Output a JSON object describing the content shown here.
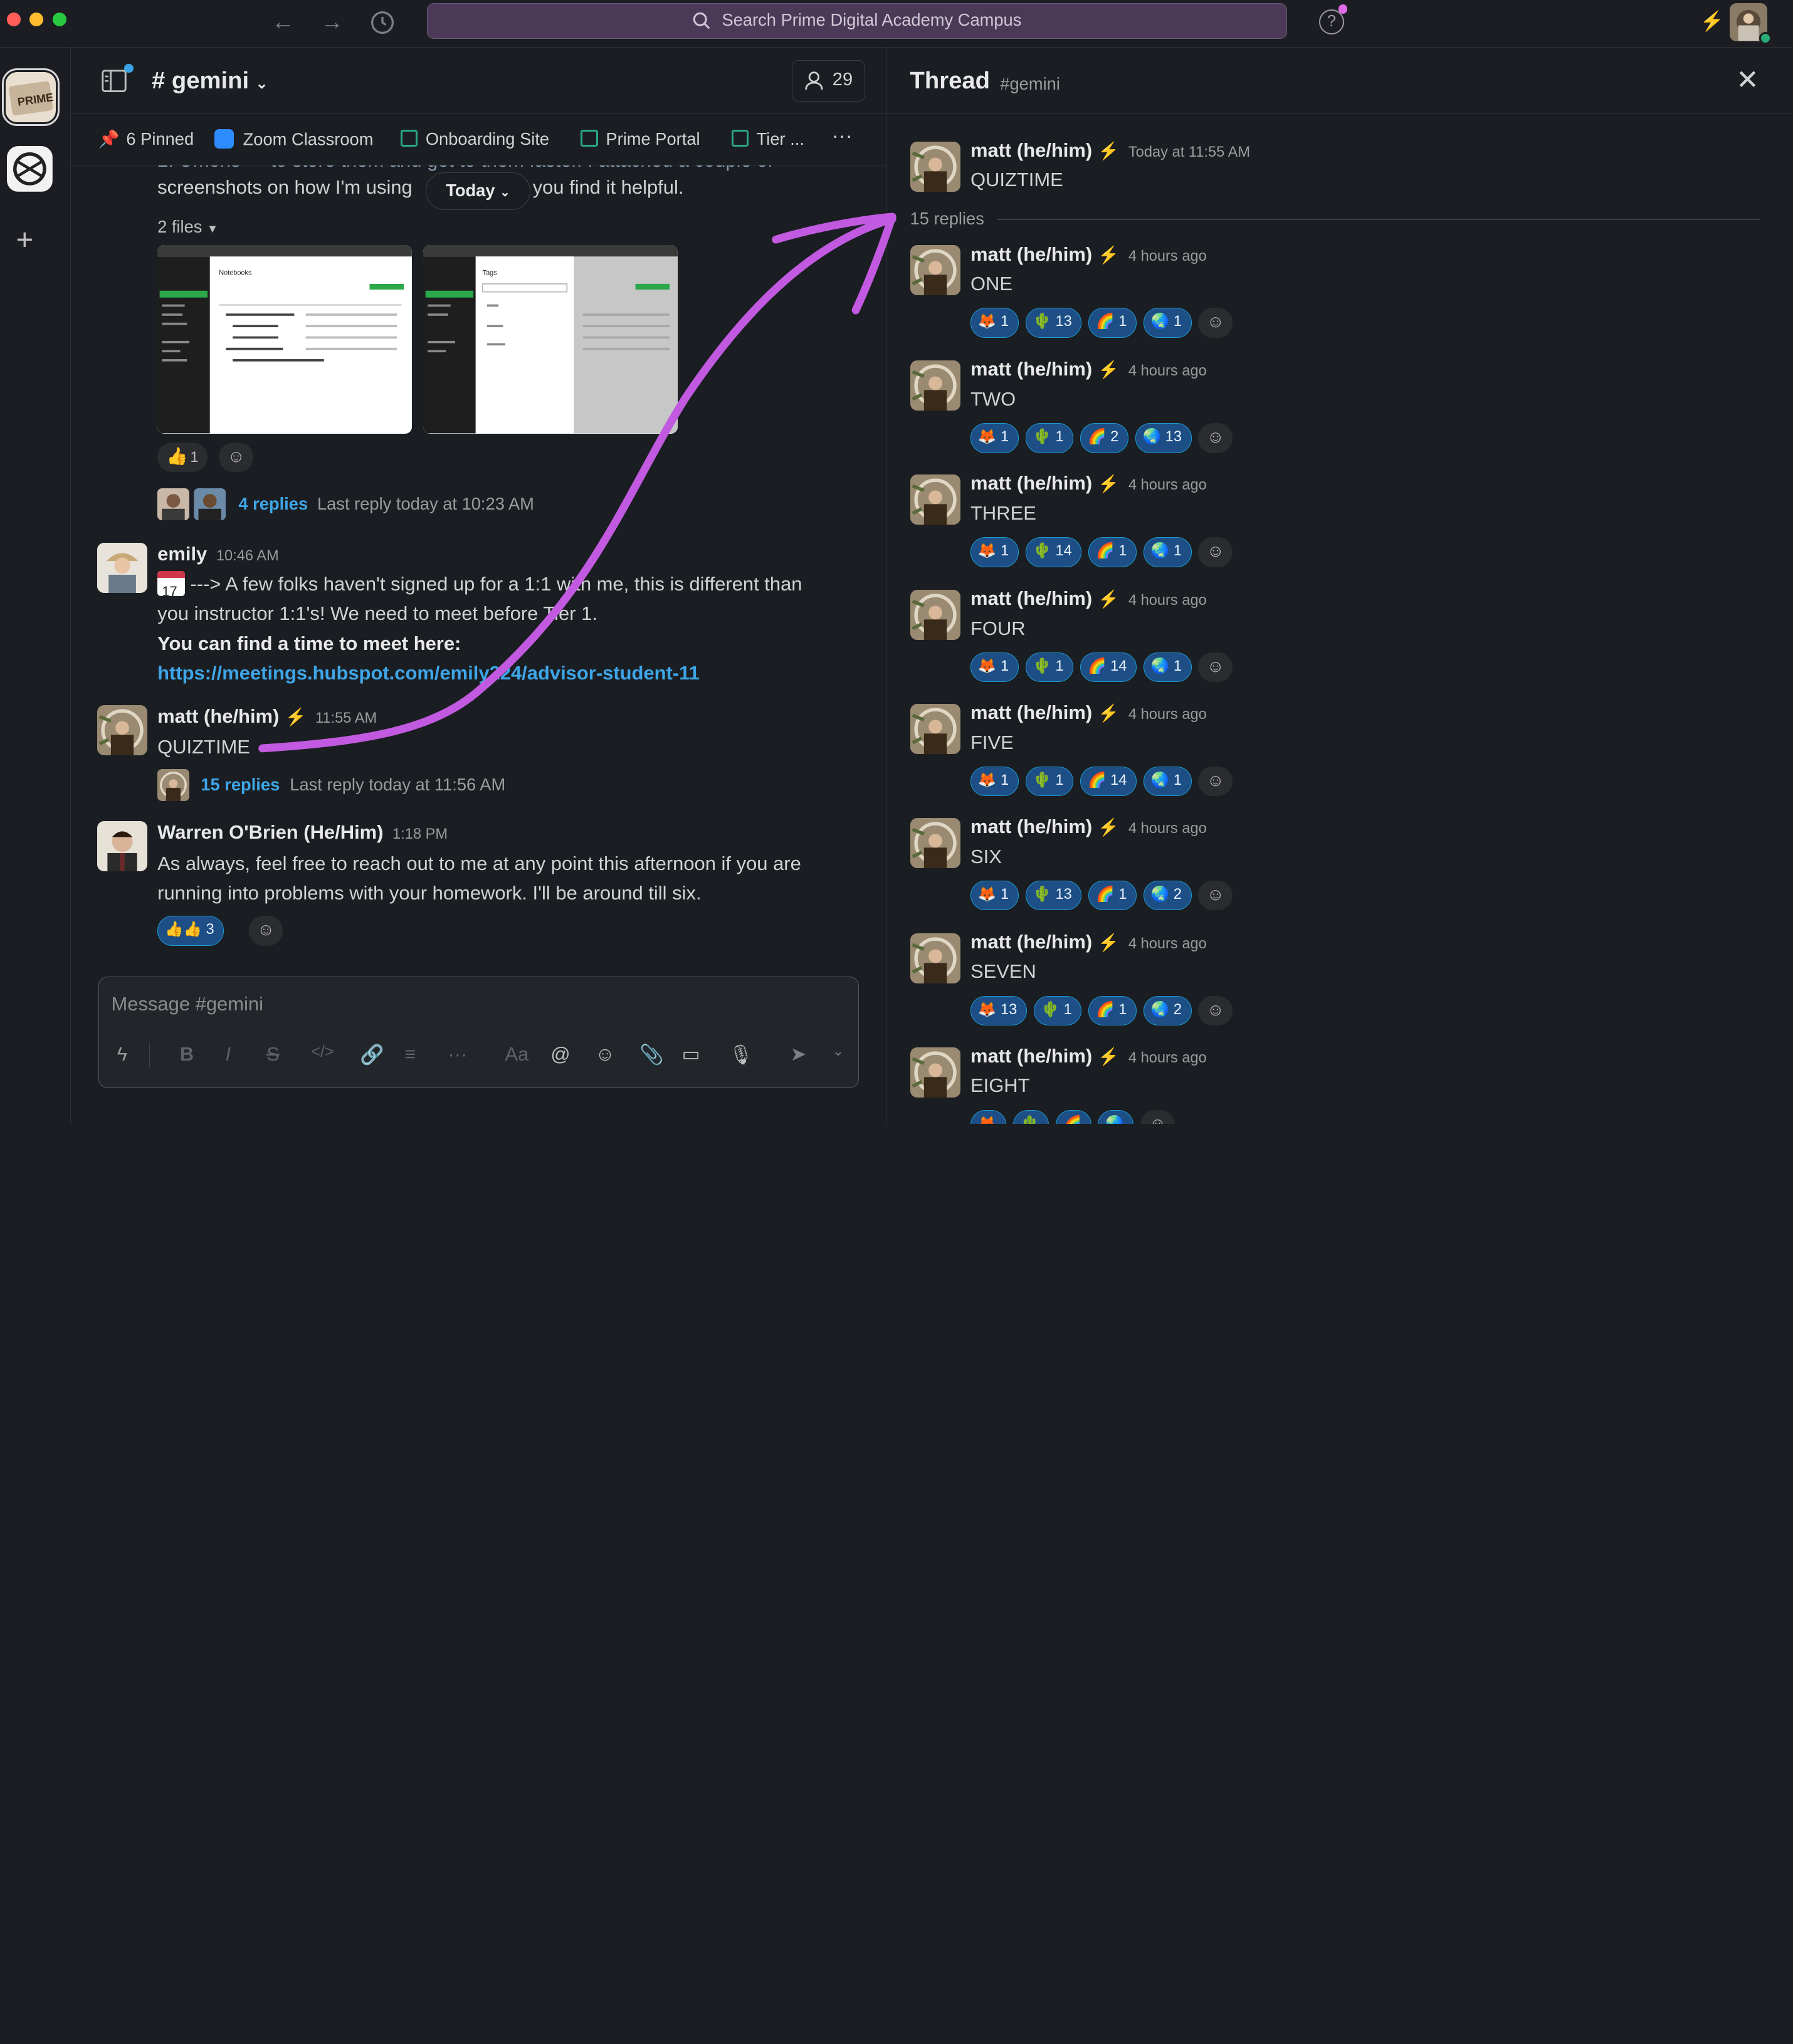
{
  "search": {
    "placeholder": "Search Prime Digital Academy Campus"
  },
  "channel": {
    "name": "# gemini",
    "members": "29"
  },
  "bookmarks": [
    "6 Pinned",
    "Zoom Classroom",
    "Onboarding Site",
    "Prime Portal",
    "Tier ..."
  ],
  "main": {
    "partial_line1": "screenshots on how I'm using",
    "partial_line1b": "f you find it helpful.",
    "date_divider": "Today",
    "files_label": "2 files",
    "thumbs_up_count": "1",
    "replies1": "4 replies",
    "last_reply1": "Last reply today at 10:23 AM",
    "emily": {
      "name": "emily",
      "time": "10:46 AM",
      "line1": "---> A few folks haven't signed up for a 1:1 with me, this is different than",
      "line2": "you instructor 1:1's! We need to meet before Tier 1.",
      "line3": "You can find a time to meet here:",
      "link": "https://meetings.hubspot.com/emily224/advisor-student-11",
      "calendar_day": "17"
    },
    "matt": {
      "name": "matt (he/him)",
      "time": "11:55 AM",
      "text": "QUIZTIME",
      "replies": "15 replies",
      "last_reply": "Last reply today at 11:56 AM"
    },
    "warren": {
      "name": "Warren O'Brien (He/Him)",
      "time": "1:18 PM",
      "line1": "As always, feel free to reach out to me at any point this afternoon if you are",
      "line2": "running into problems with your homework. I'll be around till six.",
      "reaction_count": "3"
    },
    "composer_placeholder": "Message #gemini"
  },
  "thread": {
    "title": "Thread",
    "channel": "#gemini",
    "parent": {
      "name": "matt (he/him)",
      "time": "Today at 11:55 AM",
      "text": "QUIZTIME"
    },
    "reply_count": "15 replies",
    "replies": [
      {
        "name": "matt (he/him)",
        "time": "4 hours ago",
        "text": "ONE",
        "counts": [
          "1",
          "13",
          "1",
          "1"
        ]
      },
      {
        "name": "matt (he/him)",
        "time": "4 hours ago",
        "text": "TWO",
        "counts": [
          "1",
          "1",
          "2",
          "13"
        ]
      },
      {
        "name": "matt (he/him)",
        "time": "4 hours ago",
        "text": "THREE",
        "counts": [
          "1",
          "14",
          "1",
          "1"
        ]
      },
      {
        "name": "matt (he/him)",
        "time": "4 hours ago",
        "text": "FOUR",
        "counts": [
          "1",
          "1",
          "14",
          "1"
        ]
      },
      {
        "name": "matt (he/him)",
        "time": "4 hours ago",
        "text": "FIVE",
        "counts": [
          "1",
          "1",
          "14",
          "1"
        ]
      },
      {
        "name": "matt (he/him)",
        "time": "4 hours ago",
        "text": "SIX",
        "counts": [
          "1",
          "13",
          "1",
          "2"
        ]
      },
      {
        "name": "matt (he/him)",
        "time": "4 hours ago",
        "text": "SEVEN",
        "counts": [
          "13",
          "1",
          "1",
          "2"
        ]
      },
      {
        "name": "matt (he/him)",
        "time": "4 hours ago",
        "text": "EIGHT",
        "counts": [
          "",
          "",
          "",
          ""
        ]
      }
    ],
    "emoji": [
      "🦊",
      "🌵",
      "🌈",
      "🌏"
    ]
  }
}
